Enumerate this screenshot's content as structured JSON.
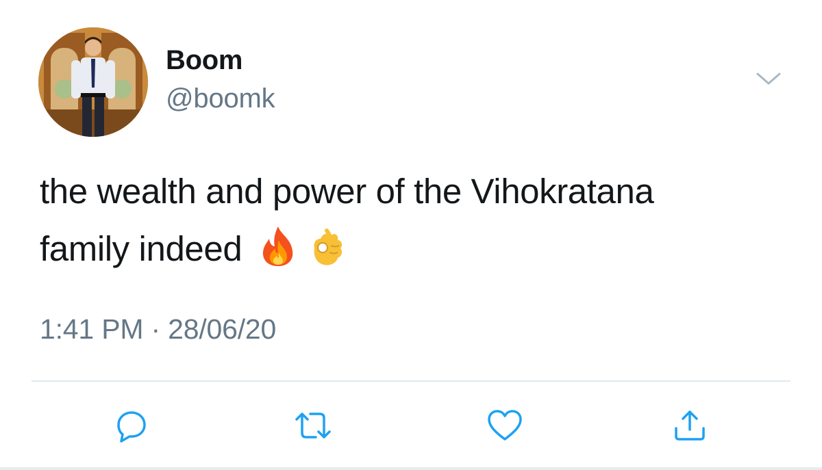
{
  "tweet": {
    "author": {
      "display_name": "Boom",
      "handle": "@boomk",
      "avatar_icon": "avatar-photo-icon"
    },
    "text_line1": "the wealth and power of the Vihokratana",
    "text_line2": "family indeed",
    "emojis": [
      "fire-emoji",
      "ok-hand-emoji"
    ],
    "timestamp": "1:41 PM · 28/06/20"
  },
  "actions": [
    "reply-icon",
    "retweet-icon",
    "like-icon",
    "share-icon"
  ],
  "colors": {
    "text_primary": "#14171a",
    "text_secondary": "#657786",
    "divider": "#e1e8ed",
    "icon": "#1da1f2"
  }
}
